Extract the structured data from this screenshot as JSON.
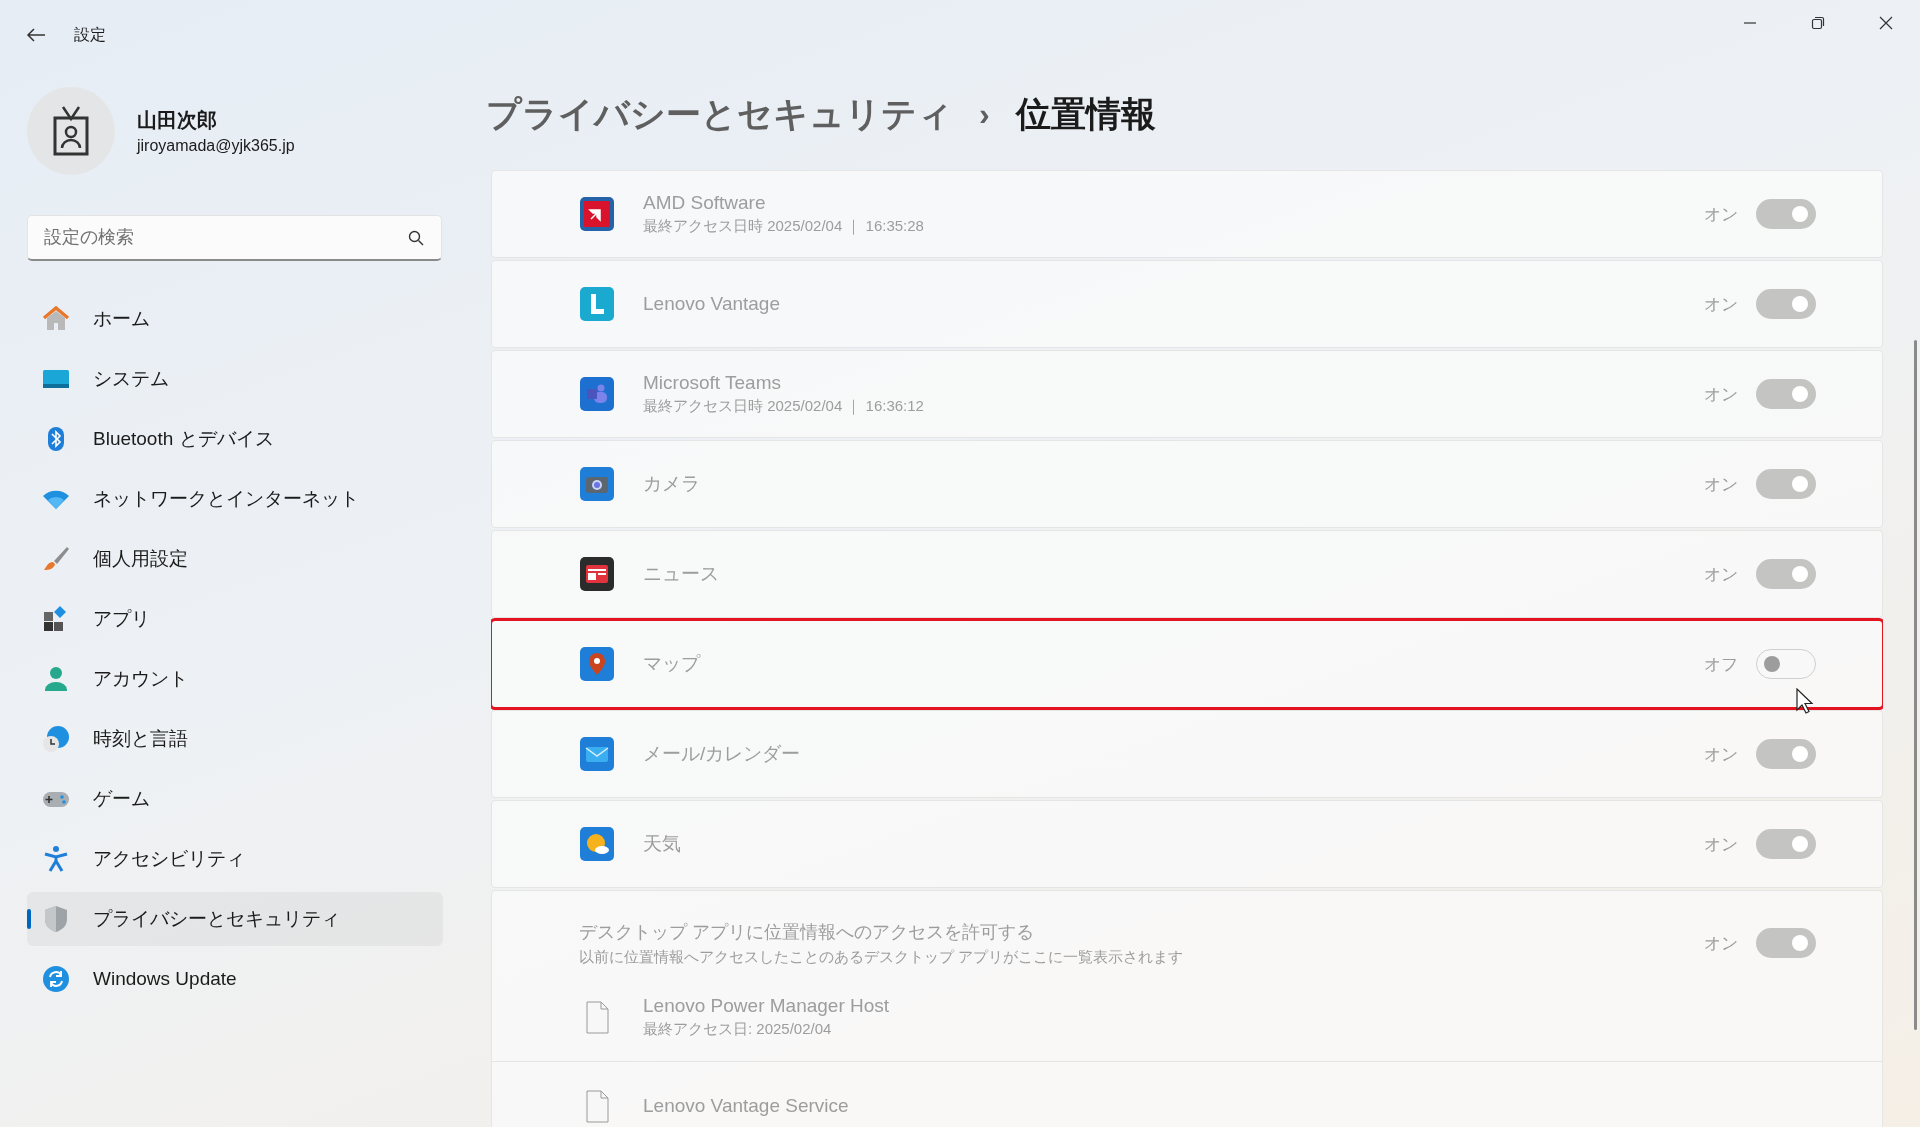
{
  "window": {
    "title": "設定"
  },
  "profile": {
    "name": "山田次郎",
    "email": "jiroyamada@yjk365.jp"
  },
  "search": {
    "placeholder": "設定の検索"
  },
  "nav": [
    {
      "label": "ホーム",
      "selected": false
    },
    {
      "label": "システム",
      "selected": false
    },
    {
      "label": "Bluetooth とデバイス",
      "selected": false
    },
    {
      "label": "ネットワークとインターネット",
      "selected": false
    },
    {
      "label": "個人用設定",
      "selected": false
    },
    {
      "label": "アプリ",
      "selected": false
    },
    {
      "label": "アカウント",
      "selected": false
    },
    {
      "label": "時刻と言語",
      "selected": false
    },
    {
      "label": "ゲーム",
      "selected": false
    },
    {
      "label": "アクセシビリティ",
      "selected": false
    },
    {
      "label": "プライバシーとセキュリティ",
      "selected": true
    },
    {
      "label": "Windows Update",
      "selected": false
    }
  ],
  "breadcrumb": {
    "parent": "プライバシーとセキュリティ",
    "separator": "›",
    "current": "位置情報"
  },
  "apps": [
    {
      "name": "AMD Software",
      "detail": "最終アクセス日時 2025/02/04 ｜ 16:35:28",
      "state_label": "オン",
      "on": true,
      "disabled": true,
      "highlighted": false
    },
    {
      "name": "Lenovo Vantage",
      "state_label": "オン",
      "on": true,
      "disabled": true,
      "highlighted": false
    },
    {
      "name": "Microsoft Teams",
      "detail": "最終アクセス日時 2025/02/04 ｜ 16:36:12",
      "state_label": "オン",
      "on": true,
      "disabled": true,
      "highlighted": false
    },
    {
      "name": "カメラ",
      "state_label": "オン",
      "on": true,
      "disabled": true,
      "highlighted": false
    },
    {
      "name": "ニュース",
      "state_label": "オン",
      "on": true,
      "disabled": true,
      "highlighted": false
    },
    {
      "name": "マップ",
      "state_label": "オフ",
      "on": false,
      "disabled": true,
      "highlighted": true
    },
    {
      "name": "メール/カレンダー",
      "state_label": "オン",
      "on": true,
      "disabled": true,
      "highlighted": false
    },
    {
      "name": "天気",
      "state_label": "オン",
      "on": true,
      "disabled": true,
      "highlighted": false
    }
  ],
  "desktop": {
    "title": "デスクトップ アプリに位置情報へのアクセスを許可する",
    "subtitle": "以前に位置情報へアクセスしたことのあるデスクトップ アプリがここに一覧表示されます",
    "state_label": "オン",
    "on": true,
    "disabled": true,
    "apps": [
      {
        "name": "Lenovo Power Manager Host",
        "detail": "最終アクセス日: 2025/02/04"
      },
      {
        "name": "Lenovo Vantage Service"
      }
    ]
  }
}
